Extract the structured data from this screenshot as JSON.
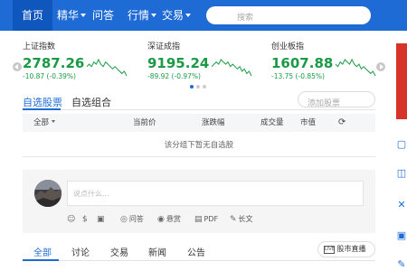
{
  "nav": {
    "items": [
      {
        "label": "首页",
        "active": true,
        "dropdown": false
      },
      {
        "label": "精华",
        "active": false,
        "dropdown": true
      },
      {
        "label": "问答",
        "active": false,
        "dropdown": false
      },
      {
        "label": "行情",
        "active": false,
        "dropdown": true
      },
      {
        "label": "交易",
        "active": false,
        "dropdown": true
      }
    ],
    "search_placeholder": "搜索"
  },
  "indices": [
    {
      "name": "上证指数",
      "value": "2787.26",
      "change": "-10.87 (-0.39%)",
      "trend": [
        6,
        5,
        6,
        4,
        5,
        3,
        5,
        6,
        4,
        5,
        6,
        7,
        6,
        7,
        8,
        9,
        8,
        10
      ]
    },
    {
      "name": "深证成指",
      "value": "9195.24",
      "change": "-89.92 (-0.97%)",
      "trend": [
        6,
        5,
        4,
        5,
        3,
        4,
        5,
        4,
        6,
        5,
        6,
        7,
        6,
        8,
        7,
        9,
        8,
        10
      ]
    },
    {
      "name": "创业板指",
      "value": "1607.88",
      "change": "-13.75 (-0.85%)",
      "trend": [
        5,
        6,
        4,
        5,
        3,
        4,
        5,
        3,
        5,
        6,
        5,
        7,
        6,
        7,
        8,
        9,
        8,
        10
      ]
    }
  ],
  "carousel": {
    "pages": 3,
    "active": 0
  },
  "watchlist": {
    "tabs": [
      {
        "label": "自选股票",
        "active": true
      },
      {
        "label": "自选组合",
        "active": false
      }
    ],
    "add_placeholder": "添加股票",
    "columns": {
      "all": "全部",
      "price": "当前价",
      "change_pct": "涨跌幅",
      "volume": "成交量",
      "market_cap": "市值",
      "refresh_icon": "refresh-icon"
    },
    "empty_message": "该分组下暂无自选股"
  },
  "composer": {
    "placeholder": "说点什么...",
    "tools": [
      {
        "icon": "emoji-icon",
        "glyph": "☺",
        "label": ""
      },
      {
        "icon": "dollar-icon",
        "glyph": "$",
        "label": ""
      },
      {
        "icon": "image-icon",
        "glyph": "▣",
        "label": ""
      },
      {
        "icon": "qa-icon",
        "glyph": "◎",
        "label": "问答"
      },
      {
        "icon": "reward-icon",
        "glyph": "◉",
        "label": "悬赏"
      },
      {
        "icon": "pdf-icon",
        "glyph": "▤",
        "label": "PDF"
      },
      {
        "icon": "long-post-icon",
        "glyph": "✎",
        "label": "长文"
      }
    ]
  },
  "feed": {
    "tabs": [
      {
        "label": "全部",
        "active": true
      },
      {
        "label": "讨论",
        "active": false
      },
      {
        "label": "交易",
        "active": false
      },
      {
        "label": "新闻",
        "active": false
      },
      {
        "label": "公告",
        "active": false
      }
    ],
    "live_tag": "LIVE",
    "live_label": "股市直播"
  },
  "colors": {
    "brand_blue": "#1e6bd6",
    "down_green": "#1a9a45",
    "side_red": "#d6332a"
  }
}
